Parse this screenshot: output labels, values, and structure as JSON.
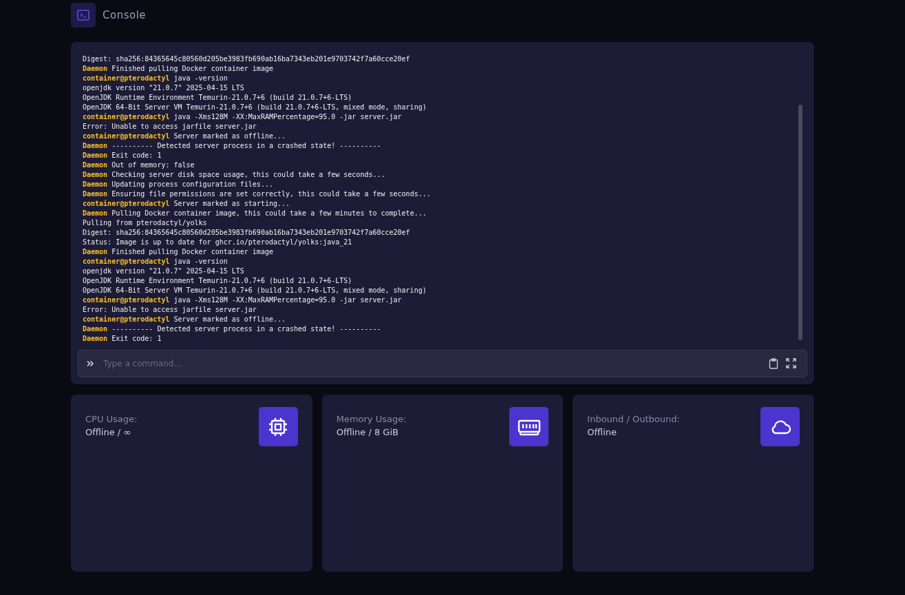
{
  "header": {
    "title": "Console"
  },
  "console": {
    "lines": [
      {
        "kind": "plain",
        "text": "Digest: sha256:84365645c80560d205be3983fb690ab16ba7343eb201e9703742f7a60cce20ef"
      },
      {
        "kind": "daemon",
        "prefix": "Daemon",
        "text": "Finished pulling Docker container image"
      },
      {
        "kind": "container",
        "prefix": "container@pterodactyl",
        "text": "java -version"
      },
      {
        "kind": "plain",
        "text": "openjdk version \"21.0.7\" 2025-04-15 LTS"
      },
      {
        "kind": "plain",
        "text": "OpenJDK Runtime Environment Temurin-21.0.7+6 (build 21.0.7+6-LTS)"
      },
      {
        "kind": "plain",
        "text": "OpenJDK 64-Bit Server VM Temurin-21.0.7+6 (build 21.0.7+6-LTS, mixed mode, sharing)"
      },
      {
        "kind": "container",
        "prefix": "container@pterodactyl",
        "text": "java -Xms128M -XX:MaxRAMPercentage=95.0 -jar server.jar"
      },
      {
        "kind": "plain",
        "text": "Error: Unable to access jarfile server.jar"
      },
      {
        "kind": "container",
        "prefix": "container@pterodactyl",
        "text": "Server marked as offline..."
      },
      {
        "kind": "daemon",
        "prefix": "Daemon",
        "text": "---------- Detected server process in a crashed state! ----------"
      },
      {
        "kind": "daemon",
        "prefix": "Daemon",
        "text": "Exit code: 1"
      },
      {
        "kind": "daemon",
        "prefix": "Daemon",
        "text": "Out of memory: false"
      },
      {
        "kind": "daemon",
        "prefix": "Daemon",
        "text": "Checking server disk space usage, this could take a few seconds..."
      },
      {
        "kind": "daemon",
        "prefix": "Daemon",
        "text": "Updating process configuration files..."
      },
      {
        "kind": "daemon",
        "prefix": "Daemon",
        "text": "Ensuring file permissions are set correctly, this could take a few seconds..."
      },
      {
        "kind": "container",
        "prefix": "container@pterodactyl",
        "text": "Server marked as starting..."
      },
      {
        "kind": "daemon",
        "prefix": "Daemon",
        "text": "Pulling Docker container image, this could take a few minutes to complete..."
      },
      {
        "kind": "plain",
        "text": "Pulling from pterodactyl/yolks"
      },
      {
        "kind": "plain",
        "text": "Digest: sha256:84365645c80560d205be3983fb690ab16ba7343eb201e9703742f7a60cce20ef"
      },
      {
        "kind": "plain",
        "text": "Status: Image is up to date for ghcr.io/pterodactyl/yolks:java_21"
      },
      {
        "kind": "daemon",
        "prefix": "Daemon",
        "text": "Finished pulling Docker container image"
      },
      {
        "kind": "container",
        "prefix": "container@pterodactyl",
        "text": "java -version"
      },
      {
        "kind": "plain",
        "text": "openjdk version \"21.0.7\" 2025-04-15 LTS"
      },
      {
        "kind": "plain",
        "text": "OpenJDK Runtime Environment Temurin-21.0.7+6 (build 21.0.7+6-LTS)"
      },
      {
        "kind": "plain",
        "text": "OpenJDK 64-Bit Server VM Temurin-21.0.7+6 (build 21.0.7+6-LTS, mixed mode, sharing)"
      },
      {
        "kind": "container",
        "prefix": "container@pterodactyl",
        "text": "java -Xms128M -XX:MaxRAMPercentage=95.0 -jar server.jar"
      },
      {
        "kind": "plain",
        "text": "Error: Unable to access jarfile server.jar"
      },
      {
        "kind": "container",
        "prefix": "container@pterodactyl",
        "text": "Server marked as offline..."
      },
      {
        "kind": "daemon",
        "prefix": "Daemon",
        "text": "---------- Detected server process in a crashed state! ----------"
      },
      {
        "kind": "daemon",
        "prefix": "Daemon",
        "text": "Exit code: 1"
      }
    ],
    "command": {
      "placeholder": "Type a command..."
    }
  },
  "stats": [
    {
      "kind": "cpu",
      "label": "CPU Usage:",
      "value": "Offline / ∞"
    },
    {
      "kind": "memory",
      "label": "Memory Usage:",
      "value": "Offline / 8 GiB"
    },
    {
      "kind": "network",
      "label": "Inbound / Outbound:",
      "value": "Offline"
    }
  ]
}
